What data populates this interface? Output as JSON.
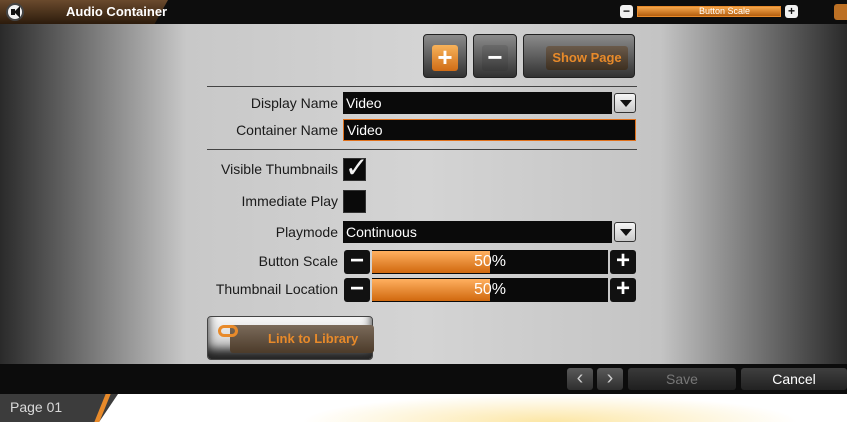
{
  "window": {
    "title": "Audio Container",
    "mini_scale_label": "Button Scale"
  },
  "toolbar": {
    "add_glyph": "+",
    "remove_glyph": "−",
    "show_page_label": "Show Page"
  },
  "form": {
    "display_name": {
      "label": "Display Name",
      "value": "Video"
    },
    "container_name": {
      "label": "Container Name",
      "value": "Video"
    },
    "visible_thumbnails": {
      "label": "Visible Thumbnails",
      "checked": true,
      "mark": "✓"
    },
    "immediate_play": {
      "label": "Immediate Play",
      "checked": false
    },
    "playmode": {
      "label": "Playmode",
      "value": "Continuous"
    },
    "button_scale": {
      "label": "Button Scale",
      "value": 50,
      "display": "50%"
    },
    "thumbnail_location": {
      "label": "Thumbnail Location",
      "value": 50,
      "display": "50%"
    },
    "link_to_library_label": "Link to Library"
  },
  "bottom": {
    "prev_glyph": "‹",
    "next_glyph": "›",
    "save_label": "Save",
    "cancel_label": "Cancel"
  },
  "footer": {
    "page_label": "Page 01"
  },
  "colors": {
    "accent": "#e88a2a",
    "panel": "#d4d4d4"
  }
}
